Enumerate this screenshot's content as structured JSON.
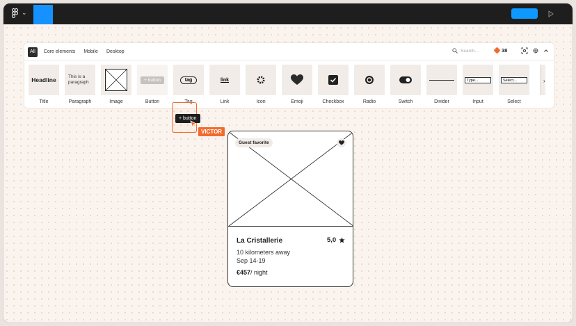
{
  "toolbar": {
    "logo_icon": "figma-logo-icon",
    "accent": "#1592ff",
    "share_color": "#0d99ff",
    "play_icon": "play-icon"
  },
  "panel": {
    "tabs": [
      "All",
      "Core elements",
      "Mobile",
      "Desktop"
    ],
    "search_placeholder": "Search...",
    "count": "38",
    "items": [
      {
        "label": "Title",
        "preview": "Headline"
      },
      {
        "label": "Paragraph",
        "preview": "This is a paragraph"
      },
      {
        "label": "Image",
        "preview": ""
      },
      {
        "label": "Button",
        "preview": "+ button"
      },
      {
        "label": "Tag",
        "preview": "tag"
      },
      {
        "label": "Link",
        "preview": "link"
      },
      {
        "label": "Icon",
        "preview": ""
      },
      {
        "label": "Emoji",
        "preview": ""
      },
      {
        "label": "Checkbox",
        "preview": ""
      },
      {
        "label": "Radio",
        "preview": ""
      },
      {
        "label": "Switch",
        "preview": ""
      },
      {
        "label": "Divider",
        "preview": ""
      },
      {
        "label": "Input",
        "preview": "Type..."
      },
      {
        "label": "Select",
        "preview": "Select..."
      }
    ]
  },
  "drag": {
    "button_label": "+ button",
    "user_name": "VICTOR",
    "user_color": "#f26b2d"
  },
  "card": {
    "badge": "Guest favorite",
    "title": "La Cristallerie",
    "rating": "5,0",
    "distance": "10 kilometers away",
    "dates": "Sep 14-19",
    "price": "€457",
    "price_unit": "/ night"
  }
}
